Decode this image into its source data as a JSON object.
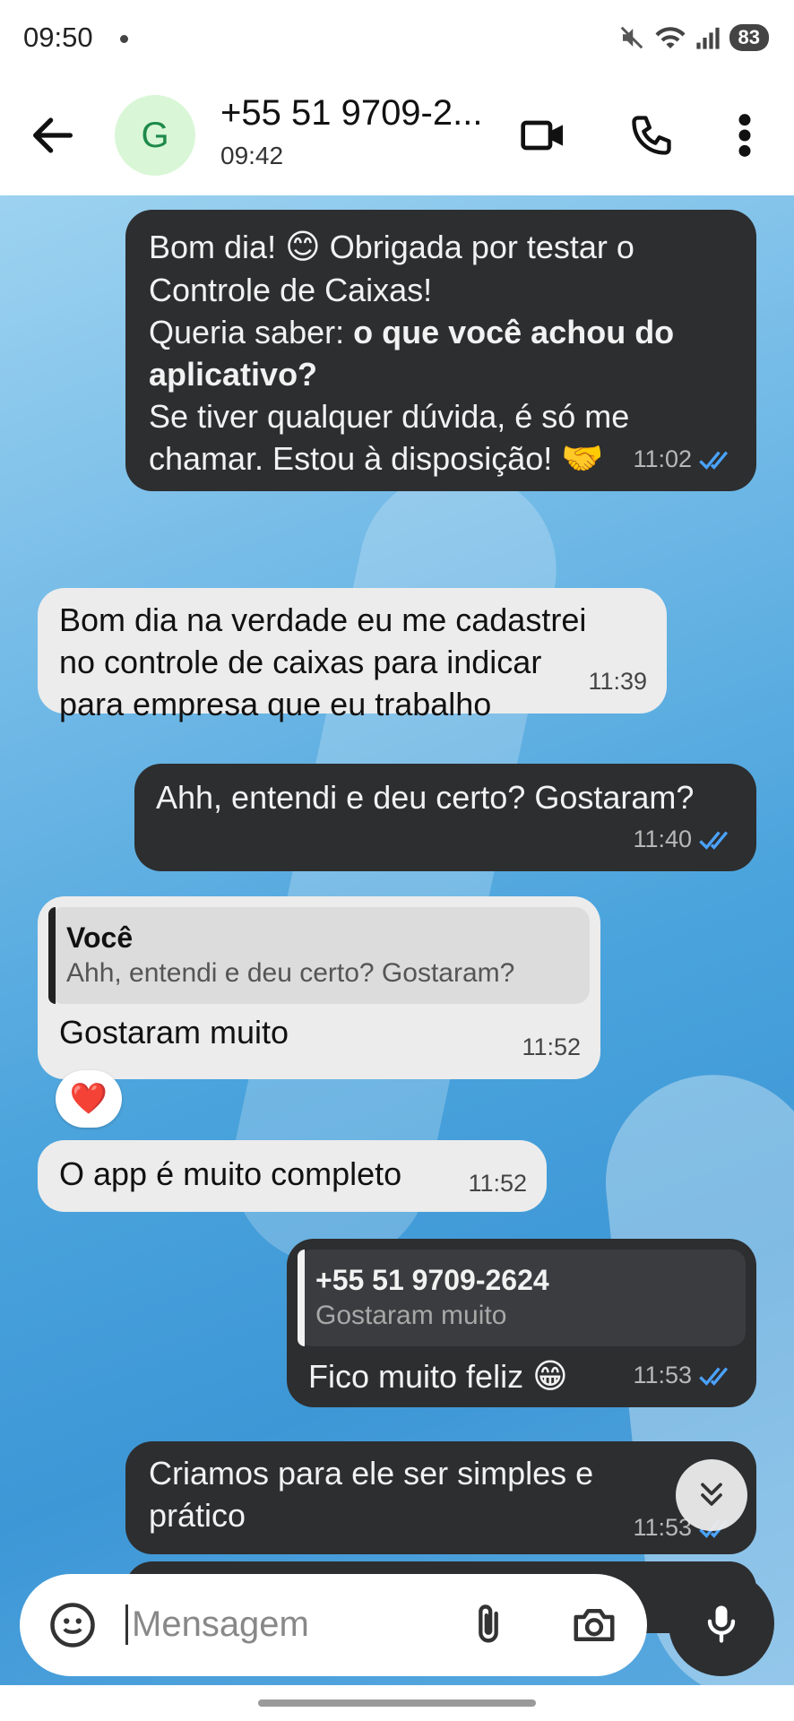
{
  "status_bar": {
    "time": "09:50",
    "battery": "83",
    "icons": [
      "mute-icon",
      "wifi-icon",
      "signal-icon",
      "battery-icon"
    ]
  },
  "header": {
    "avatar_letter": "G",
    "contact_name": "+55 51 9709-2...",
    "last_seen": "09:42"
  },
  "messages": [
    {
      "id": "m1",
      "direction": "outgoing",
      "text_line1_a": "Bom dia!",
      "emoji1": "😊",
      "text_line1_b": "Obrigada por testar o",
      "text_line2": "Controle de Caixas!",
      "text_line3_a": "Queria saber:",
      "text_line3_b": "o que você achou do",
      "text_line4": "aplicativo?",
      "text_line5": "Se tiver qualquer dúvida, é só me",
      "text_line6": "chamar. Estou à disposição!",
      "emoji2": "🤝",
      "time": "11:02",
      "status": "read"
    },
    {
      "id": "m2",
      "direction": "incoming",
      "text_line1": "Bom dia na verdade eu me cadastrei",
      "text_line2": "no controle de caixas para indicar",
      "text_line3": "para empresa que eu trabalho",
      "time": "11:39"
    },
    {
      "id": "m3",
      "direction": "outgoing",
      "text": "Ahh, entendi e deu certo? Gostaram?",
      "time": "11:40",
      "status": "read"
    },
    {
      "id": "m4",
      "direction": "incoming",
      "quote_author": "Você",
      "quote_text": "Ahh, entendi e deu certo? Gostaram?",
      "text": "Gostaram muito",
      "time": "11:52",
      "reaction": "❤️"
    },
    {
      "id": "m5",
      "direction": "incoming",
      "text": "O app é muito completo",
      "time": "11:52"
    },
    {
      "id": "m6",
      "direction": "outgoing",
      "quote_author": "+55 51 9709-2624",
      "quote_text": "Gostaram muito",
      "text": "Fico muito feliz",
      "emoji": "😁",
      "time": "11:53",
      "status": "read"
    },
    {
      "id": "m7",
      "direction": "outgoing",
      "text_line1": "Criamos para ele ser simples e",
      "text_line2": "prático",
      "time": "11:53",
      "status": "read"
    }
  ],
  "composer": {
    "placeholder": "Mensagem"
  },
  "colors": {
    "outgoing_bubble": "#2d2e30",
    "incoming_bubble": "#ececec",
    "read_tick": "#4aa3ff",
    "avatar_bg": "#d9f7d6",
    "avatar_fg": "#1e8a4a"
  }
}
